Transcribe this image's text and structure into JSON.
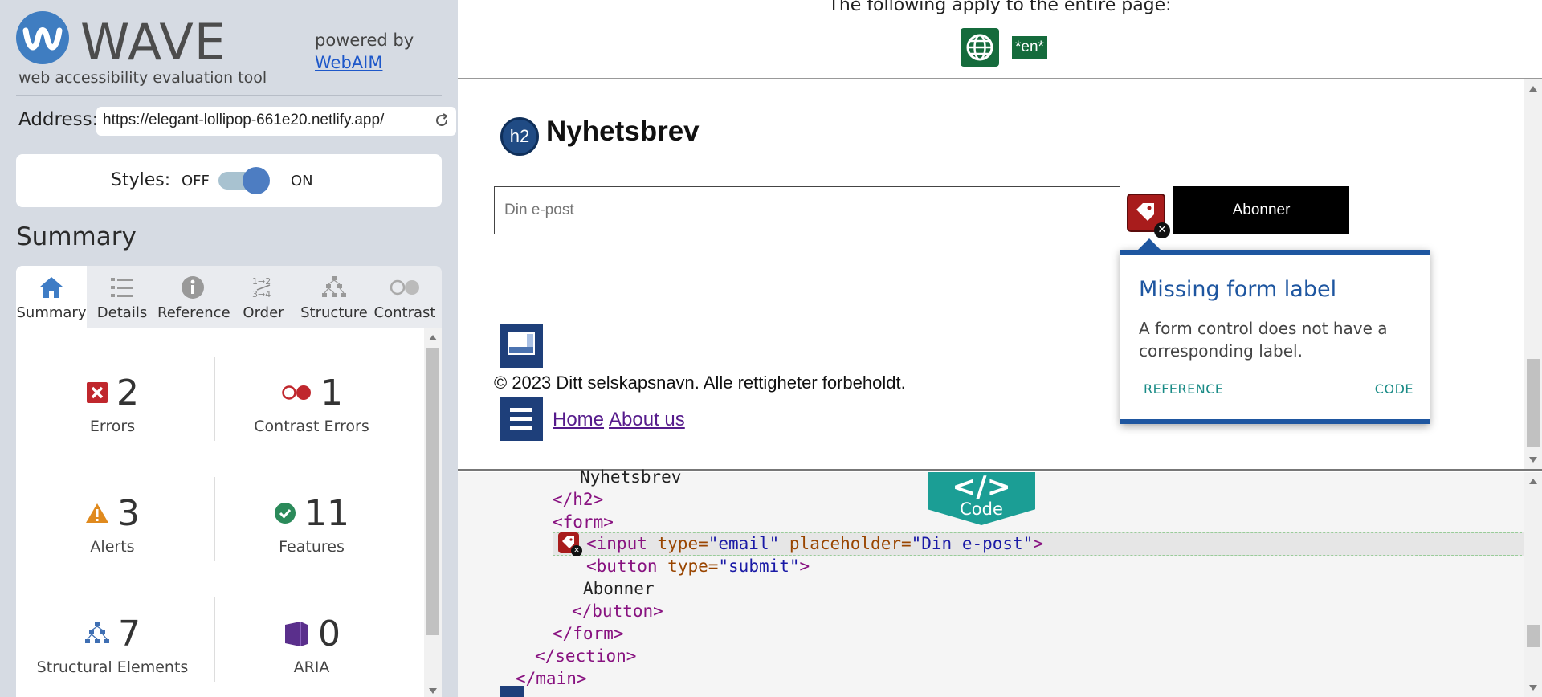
{
  "sidebar": {
    "logo": {
      "title": "WAVE",
      "subtitle": "web accessibility evaluation tool"
    },
    "powered_by": {
      "text": "powered by",
      "link": "WebAIM"
    },
    "address": {
      "label": "Address:",
      "value": "https://elegant-lollipop-661e20.netlify.app/"
    },
    "styles": {
      "label": "Styles:",
      "off": "OFF",
      "on": "ON",
      "state": "on"
    },
    "summary_title": "Summary",
    "tabs": [
      {
        "label": "Summary",
        "icon": "home-icon",
        "active": true
      },
      {
        "label": "Details",
        "icon": "list-icon",
        "active": false
      },
      {
        "label": "Reference",
        "icon": "info-icon",
        "active": false
      },
      {
        "label": "Order",
        "icon": "order-icon",
        "active": false
      },
      {
        "label": "Structure",
        "icon": "structure-icon",
        "active": false
      },
      {
        "label": "Contrast",
        "icon": "contrast-icon",
        "active": false
      }
    ],
    "stats": {
      "errors": {
        "count": "2",
        "label": "Errors",
        "color": "#c0272d"
      },
      "contrast_errors": {
        "count": "1",
        "label": "Contrast Errors",
        "color": "#c0272d"
      },
      "alerts": {
        "count": "3",
        "label": "Alerts",
        "color": "#e08a1e"
      },
      "features": {
        "count": "11",
        "label": "Features",
        "color": "#2b8a5a"
      },
      "structural": {
        "count": "7",
        "label": "Structural Elements",
        "color": "#3f6fb3"
      },
      "aria": {
        "count": "0",
        "label": "ARIA",
        "color": "#5a2f8c"
      }
    }
  },
  "main": {
    "top_text": "The following apply to the entire page:",
    "lang_badge": "*en*",
    "page": {
      "h2_icon": "h2",
      "heading": "Nyhetsbrev",
      "email_placeholder": "Din e-post",
      "subscribe_label": "Abonner",
      "copyright": "© 2023 Ditt selskapsnavn. Alle rettigheter forbeholdt.",
      "links": [
        "Home",
        "About us"
      ]
    },
    "tooltip": {
      "title": "Missing form label",
      "description": "A form control does not have a corresponding label.",
      "reference": "REFERENCE",
      "code": "CODE"
    },
    "code_badge": {
      "symbol": "</>",
      "label": "Code"
    },
    "code": {
      "line1": "Nyhetsbrev",
      "line2": "</h2>",
      "line3": "<form>",
      "input_open": "<input",
      "input_type_attr": "type=",
      "input_type_val": "\"email\"",
      "input_ph_attr": "placeholder=",
      "input_ph_val": "\"Din e-post\"",
      "input_close": ">",
      "button_open": "<button",
      "button_type_attr": "type=",
      "button_type_val": "\"submit\"",
      "button_close": ">",
      "button_text": "Abonner",
      "button_end": "</button>",
      "form_end": "</form>",
      "section_end": "</section>",
      "main_end": "</main>"
    }
  },
  "colors": {
    "accent": "#1e56a0",
    "teal": "#1b9e95",
    "green": "#156b3c",
    "error_red": "#a81c1c"
  }
}
